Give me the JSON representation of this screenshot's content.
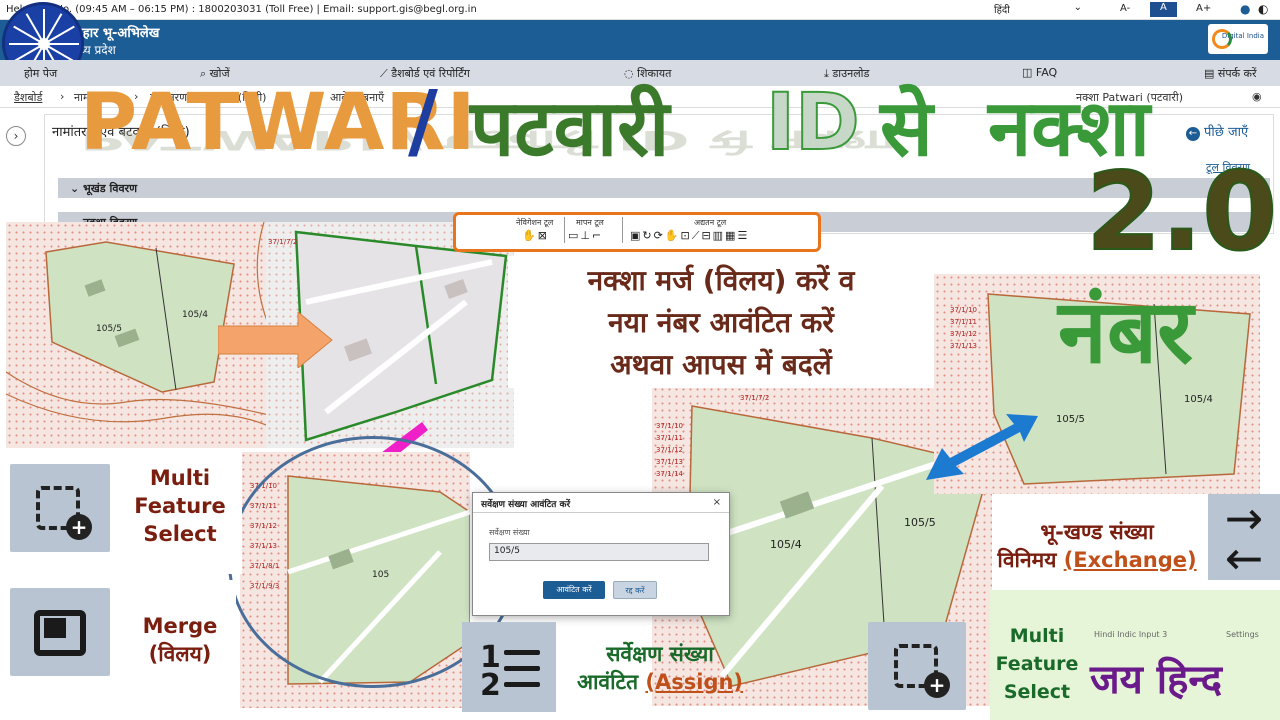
{
  "topbar": {
    "info": "Helpdesk No. (09:45 AM – 06:15 PM) : 1800203031 (Toll Free) | Email: support.gis@begl.org.in",
    "language": "हिंदी",
    "font_small": "A-",
    "font_normal": "A",
    "font_large": "A+"
  },
  "header": {
    "title": "बिहार भू-अभिलेख",
    "subtitle": "मध्य प्रदेश",
    "digital_india": "Digital India"
  },
  "nav": {
    "home": "होम पेज",
    "search": "खोजें",
    "dashboard": "डैशबोर्ड एवं रिपोर्टिंग",
    "complaint": "शिकायत",
    "download": "डाउनलोड",
    "faq": "FAQ",
    "contact": "संपर्क करें"
  },
  "breadcrumb": {
    "dashboard": "डैशबोर्ड",
    "namantaran": "नामांतरण",
    "batwara": "नामांतरण एवं बटवारा (निजी)",
    "update": "आवेदन बनाएँ",
    "user": "नक्शा Patwari (पटवारी)"
  },
  "page": {
    "card_title": "नामांतरण एवं बटवारा (निजी)",
    "back": "पीछे जाएँ",
    "acc1": "भूखंड विवरण",
    "acc2": "नक्शा विवरण",
    "tool_link": "टूल विवरण"
  },
  "toolbar": {
    "group1": "नेविगेशन टूल",
    "group2": "मापन टूल",
    "group3": "अद्यतन टूल"
  },
  "overlay": {
    "patwari": "PATWARI",
    "slash": "/",
    "patwari_hi": "पटवारी",
    "id": "ID",
    "se": "से",
    "naksha": "नक्शा",
    "version": "2.0",
    "nambar": "नंबर",
    "instruction_l1": "नक्शा मर्ज (विलय) करें व",
    "instruction_l2": "नया नंबर आवंटित करें",
    "instruction_l3": "अथवा आपस में बदलें",
    "jai_hind": "जय हिन्द"
  },
  "features": {
    "multi_select_l1": "Multi",
    "multi_select_l2": "Feature",
    "multi_select_l3": "Select",
    "merge_l1": "Merge",
    "merge_l2": "(विलय)",
    "assign_l1": "सर्वेक्षण संख्या",
    "assign_l2": "आवंटित",
    "assign_en": "(Assign)",
    "exchange_l1": "भू-खण्ड संख्या",
    "exchange_l2": "विनिमय",
    "exchange_en": "(Exchange)",
    "multi2_l1": "Multi",
    "multi2_l2": "Feature",
    "multi2_l3": "Select",
    "hindi_input": "Hindi Indic Input 3",
    "settings": "Settings"
  },
  "dialog": {
    "title": "सर्वेक्षण संख्या आवंटित करें",
    "field_label": "सर्वेक्षण संख्या",
    "value": "105/5",
    "assign_btn": "आवंटित करें",
    "cancel_btn": "रद्द करें"
  },
  "map_labels": {
    "p1": "105/5",
    "p2": "105/4",
    "p3": "105",
    "p4": "105/4",
    "p5": "105/5",
    "p6": "105/5",
    "p7": "105/4",
    "r1": "37/1/7/2",
    "r2": "37/1/10",
    "r3": "37/1/11",
    "r4": "37/1/12",
    "r5": "37/1/13",
    "r6": "37/1/14",
    "r7": "37/1/15",
    "r8": "37/1/8/1",
    "r9": "37/1/9/3"
  }
}
